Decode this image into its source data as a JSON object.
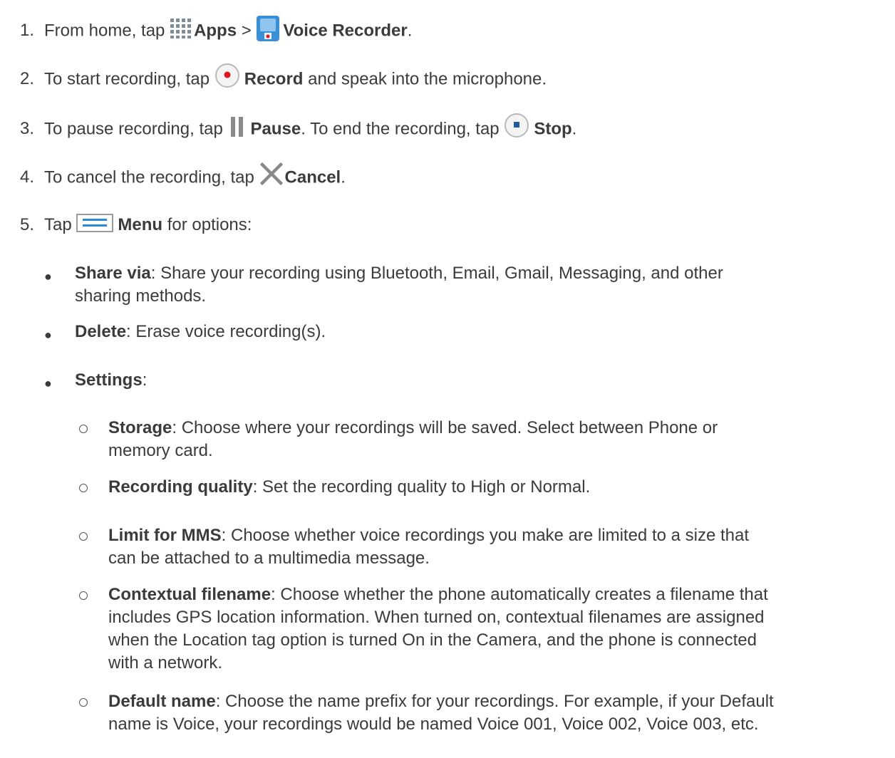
{
  "steps": [
    {
      "num": "1.",
      "text_a": "From home, tap ",
      "bold_a": "Apps",
      "text_b": " > ",
      "bold_b": "Voice Recorder",
      "text_c": "."
    },
    {
      "num": "2.",
      "text_a": "To start recording, tap ",
      "bold_a": "Record",
      "text_b": " and speak into the microphone."
    },
    {
      "num": "3.",
      "text_a": "To pause recording, tap ",
      "bold_a": "Pause",
      "text_b": ". To end the recording, tap ",
      "bold_b": "Stop",
      "text_c": "."
    },
    {
      "num": "4.",
      "text_a": "To cancel the recording, tap ",
      "bold_a": "Cancel",
      "text_b": "."
    },
    {
      "num": "5.",
      "text_a": "Tap ",
      "bold_a": "Menu",
      "text_b": " for options:"
    }
  ],
  "menu_options": [
    {
      "term": "Share via",
      "desc_1": ": Share your recording using Bluetooth, Email, Gmail, Messaging, and other",
      "desc_2": "sharing methods."
    },
    {
      "term": "Delete",
      "desc_1": ": Erase voice recording(s)."
    },
    {
      "term": "Settings",
      "desc_1": ":"
    }
  ],
  "settings_options": [
    {
      "term": "Storage",
      "desc_1": ": Choose where your recordings will be saved. Select between Phone or",
      "desc_2": "memory card."
    },
    {
      "term": "Recording quality",
      "desc_1": ": Set the recording quality to High or Normal."
    },
    {
      "term": "Limit for MMS",
      "desc_1": ": Choose whether voice recordings you make are limited to a size that",
      "desc_2": "can be attached to a multimedia message."
    },
    {
      "term": "Contextual filename",
      "desc_1": ": Choose whether the phone automatically creates a filename that",
      "desc_2": "includes GPS location information. When turned on, contextual filenames are assigned",
      "desc_3": "when the Location tag option is turned On in the Camera, and the phone is connected",
      "desc_4": "with a network."
    },
    {
      "term": "Default name",
      "desc_1": ": Choose the name prefix for your recordings. For example, if your Default",
      "desc_2": "name is Voice, your recordings would be named Voice 001, Voice 002, Voice 003, etc."
    }
  ],
  "icons": {
    "apps": "apps-grid-icon",
    "voice_recorder": "voice-recorder-app-icon",
    "record": "record-icon",
    "pause": "pause-icon",
    "stop": "stop-icon",
    "cancel": "cancel-x-icon",
    "menu": "menu-icon"
  },
  "colors": {
    "text": "#3b3b3b",
    "record_red": "#e0141e",
    "recorder_blue": "#3a8fd6",
    "stop_blue": "#1f5aa0"
  }
}
